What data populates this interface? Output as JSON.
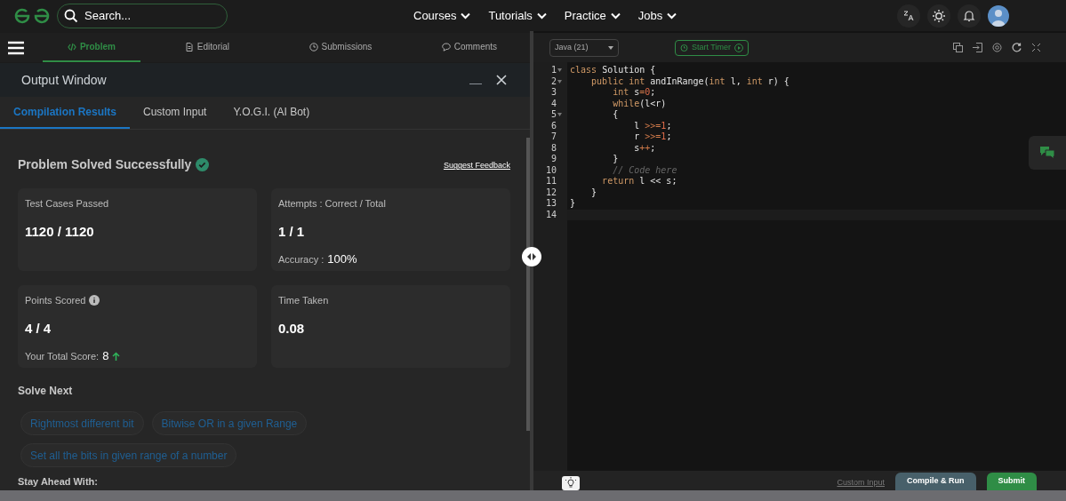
{
  "nav": {
    "search": {
      "placeholder": "Search..."
    },
    "menus": [
      "Courses",
      "Tutorials",
      "Practice",
      "Jobs"
    ]
  },
  "problem_tabs": [
    {
      "label": "Problem",
      "selected": true
    },
    {
      "label": "Editorial",
      "selected": false
    },
    {
      "label": "Submissions",
      "selected": false
    },
    {
      "label": "Comments",
      "selected": false
    }
  ],
  "output_window": {
    "title": "Output Window",
    "tabs": [
      {
        "label": "Compilation Results",
        "selected": true
      },
      {
        "label": "Custom Input",
        "selected": false
      },
      {
        "label": "Y.O.G.I. (AI Bot)",
        "selected": false
      }
    ],
    "status": "Problem Solved Successfully",
    "feedback_link": "Suggest Feedback",
    "cards": [
      {
        "label": "Test Cases Passed",
        "value": "1120 / 1120"
      },
      {
        "label": "Attempts : Correct / Total",
        "value": "1 / 1",
        "sub_label": "Accuracy :",
        "sub_value": "100%"
      },
      {
        "label": "Points Scored",
        "info": true,
        "value": "4 / 4",
        "sub_label": "Your Total Score:",
        "sub_value": "8",
        "trend_up": true
      },
      {
        "label": "Time Taken",
        "value": "0.08"
      }
    ],
    "solve_next_title": "Solve Next",
    "solve_next": [
      "Rightmost different bit",
      "Bitwise OR in a given Range",
      "Set all the bits in given range of a number"
    ],
    "stay_ahead_title": "Stay Ahead With:"
  },
  "editor": {
    "language": "Java (21)",
    "timer_button": "Start Timer",
    "lines": [
      {
        "number": "1",
        "fold": true,
        "tokens": [
          {
            "text": "class",
            "kind": "kw"
          },
          {
            "text": " Solution {",
            "kind": "plain"
          }
        ]
      },
      {
        "number": "2",
        "fold": true,
        "tokens": [
          {
            "text": "    public int",
            "kind": "kw"
          },
          {
            "text": " andInRange(",
            "kind": "plain"
          },
          {
            "text": "int",
            "kind": "kw"
          },
          {
            "text": " l, ",
            "kind": "plain"
          },
          {
            "text": "int",
            "kind": "kw"
          },
          {
            "text": " r) {",
            "kind": "plain"
          }
        ]
      },
      {
        "number": "3",
        "fold": false,
        "tokens": [
          {
            "text": "        int",
            "kind": "kw"
          },
          {
            "text": " s",
            "kind": "plain"
          },
          {
            "text": "=",
            "kind": "op"
          },
          {
            "text": "0",
            "kind": "num"
          },
          {
            "text": ";",
            "kind": "plain"
          }
        ]
      },
      {
        "number": "4",
        "fold": false,
        "tokens": [
          {
            "text": "        while",
            "kind": "kw"
          },
          {
            "text": "(l<r)",
            "kind": "plain"
          }
        ]
      },
      {
        "number": "5",
        "fold": true,
        "tokens": [
          {
            "text": "        {",
            "kind": "plain"
          }
        ]
      },
      {
        "number": "6",
        "fold": false,
        "tokens": [
          {
            "text": "            l ",
            "kind": "plain"
          },
          {
            "text": ">>=",
            "kind": "op"
          },
          {
            "text": "1",
            "kind": "num"
          },
          {
            "text": ";",
            "kind": "plain"
          }
        ]
      },
      {
        "number": "7",
        "fold": false,
        "tokens": [
          {
            "text": "            r ",
            "kind": "plain"
          },
          {
            "text": ">>=",
            "kind": "op"
          },
          {
            "text": "1",
            "kind": "num"
          },
          {
            "text": ";",
            "kind": "plain"
          }
        ]
      },
      {
        "number": "8",
        "fold": false,
        "tokens": [
          {
            "text": "            s",
            "kind": "plain"
          },
          {
            "text": "++",
            "kind": "op"
          },
          {
            "text": ";",
            "kind": "plain"
          }
        ]
      },
      {
        "number": "9",
        "fold": false,
        "tokens": [
          {
            "text": "        }",
            "kind": "plain"
          }
        ]
      },
      {
        "number": "10",
        "fold": false,
        "tokens": [
          {
            "text": "        // Code here",
            "kind": "comment"
          }
        ]
      },
      {
        "number": "11",
        "fold": false,
        "tokens": [
          {
            "text": "      return",
            "kind": "kw"
          },
          {
            "text": " l << s;",
            "kind": "plain"
          }
        ]
      },
      {
        "number": "12",
        "fold": false,
        "tokens": [
          {
            "text": "    }",
            "kind": "plain"
          }
        ]
      },
      {
        "number": "13",
        "fold": false,
        "tokens": [
          {
            "text": "}",
            "kind": "plain"
          }
        ]
      },
      {
        "number": "14",
        "fold": false,
        "current": true
      }
    ],
    "custom_input_link": "Custom Input",
    "compile_button": "Compile & Run",
    "submit_button": "Submit"
  }
}
